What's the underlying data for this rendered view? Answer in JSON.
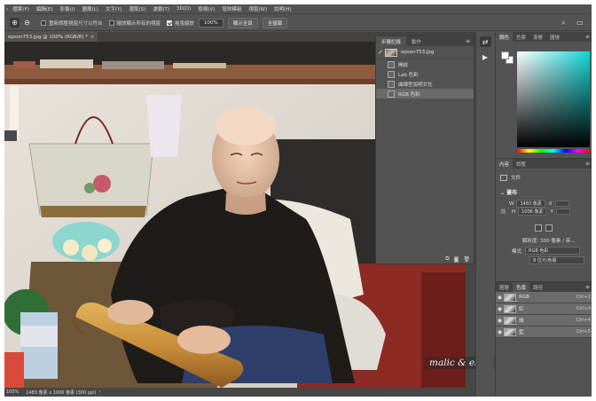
{
  "menu": [
    "檔案(F)",
    "編輯(E)",
    "影像(I)",
    "圖層(L)",
    "文字(Y)",
    "選取(S)",
    "濾鏡(T)",
    "3D(D)",
    "檢視(V)",
    "增效模組",
    "視窗(W)",
    "說明(H)"
  ],
  "options": {
    "check1": "重新調整視窗尺寸以符合",
    "check2": "縮放顯示所有的視窗",
    "check3": "拖曳縮放",
    "zoom_value": "100%",
    "fit_screen": "顯示全頁",
    "fill_screen": "全螢幕"
  },
  "document": {
    "tab_title": "epson753.jpg @ 100% (RGB/8) *",
    "close_glyph": "×"
  },
  "status": {
    "zoom": "100%",
    "size": "1483 像素 x 1006 像素 (300 ppi)",
    "arrow": "›"
  },
  "history": {
    "tabs": [
      "步驟記錄",
      "動作"
    ],
    "snapshot_name": "epson753.jpg",
    "items": [
      "開啟",
      "Lab 色彩",
      "曲線型說明文化",
      "RGB 色彩"
    ],
    "selected_index": 3
  },
  "color_panel": {
    "tabs": [
      "顏色",
      "色票",
      "漸層",
      "圖樣"
    ],
    "foreground": "#ffffff",
    "background": "#ffffff",
    "picker_hue": "#10d7d7"
  },
  "properties": {
    "tabs": [
      "內容",
      "調整"
    ],
    "doc_label": "文件",
    "canvas_label": "畫布",
    "w_label": "W",
    "w_value": "1483 像素",
    "x_label": "X",
    "h_label": "H",
    "h_value": "1006 像素",
    "y_label": "Y",
    "resolution": "解析度: 300 像素 / 英...",
    "mode_label": "模式",
    "mode_value": "RGB 色彩",
    "depth_value": "8 位元/色版"
  },
  "layers": {
    "tabs": [
      "圖層",
      "色版",
      "路徑"
    ],
    "channels": [
      {
        "name": "RGB",
        "shortcut": "Ctrl+2"
      },
      {
        "name": "紅",
        "shortcut": "Ctrl+3"
      },
      {
        "name": "綠",
        "shortcut": "Ctrl+4"
      },
      {
        "name": "藍",
        "shortcut": "Ctrl+5"
      }
    ]
  },
  "watermark": "malic & esther's underdog"
}
